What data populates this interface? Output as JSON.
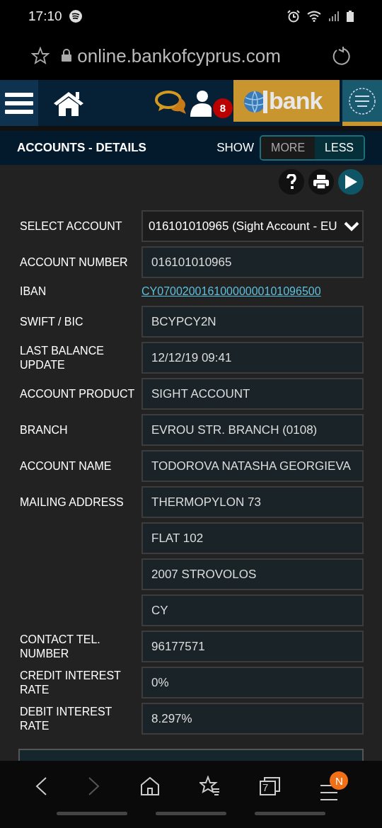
{
  "status_bar": {
    "time": "17:10"
  },
  "browser": {
    "url": "online.bankofcyprus.com"
  },
  "nav": {
    "notification_count": "8",
    "logo_text": "bank"
  },
  "header": {
    "title": "ACCOUNTS - DETAILS",
    "show_label": "SHOW",
    "toggle": [
      {
        "label": "MORE",
        "selected": false
      },
      {
        "label": "LESS",
        "selected": true
      }
    ]
  },
  "fields": [
    {
      "kind": "select",
      "label": "SELECT ACCOUNT",
      "value": "016101010965 (Sight Account - EU"
    },
    {
      "kind": "text",
      "label": "ACCOUNT NUMBER",
      "value": "016101010965"
    },
    {
      "kind": "link",
      "label": "IBAN",
      "value": "CY07002001610000000101096500"
    },
    {
      "kind": "text",
      "label": "SWIFT / BIC",
      "value": "BCYPCY2N"
    },
    {
      "kind": "text",
      "label": "LAST BALANCE UPDATE",
      "value": "12/12/19 09:41"
    },
    {
      "kind": "text",
      "label": "ACCOUNT PRODUCT",
      "value": "SIGHT ACCOUNT"
    },
    {
      "kind": "text",
      "label": "BRANCH",
      "value": "EVROU STR. BRANCH (0108)"
    },
    {
      "kind": "text",
      "label": "ACCOUNT NAME",
      "value": "TODOROVA NATASHA GEORGIEVA"
    },
    {
      "kind": "text",
      "label": "MAILING ADDRESS",
      "value": "THERMOPYLON 73"
    },
    {
      "kind": "text",
      "value": "FLAT 102"
    },
    {
      "kind": "text",
      "value": "2007 STROVOLOS"
    },
    {
      "kind": "text",
      "value": "CY"
    },
    {
      "kind": "text",
      "label": "CONTACT TEL. NUMBER",
      "value": "96177571"
    },
    {
      "kind": "text",
      "label": "CREDIT INTEREST RATE",
      "value": "0%"
    },
    {
      "kind": "text",
      "label": "DEBIT INTEREST RATE",
      "value": "8.297%"
    }
  ],
  "bottom_nav": {
    "back_disabled": false,
    "forward_disabled": true,
    "tab_count": "7",
    "menu_badge": "N"
  }
}
